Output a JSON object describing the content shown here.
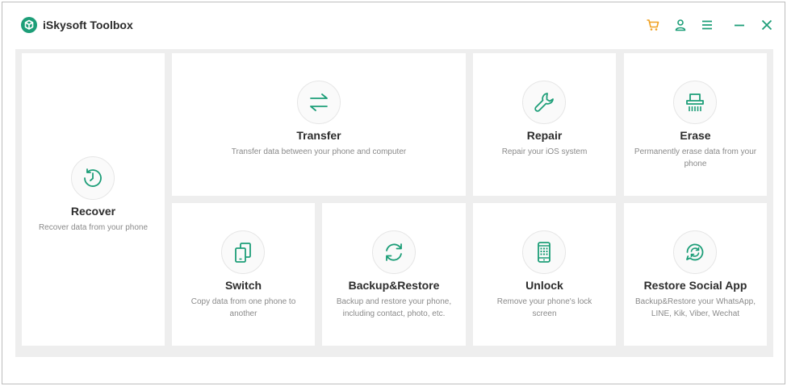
{
  "app": {
    "title": "iSkysoft Toolbox"
  },
  "toolbar": {
    "cart_icon": "cart-icon",
    "account_icon": "account-icon",
    "menu_icon": "menu-icon",
    "minimize_icon": "minimize-icon",
    "close_icon": "close-icon"
  },
  "colors": {
    "accent": "#1d9e78",
    "cart": "#f0a020",
    "background": "#eeeeee",
    "card": "#ffffff"
  },
  "cards": {
    "recover": {
      "title": "Recover",
      "desc": "Recover data from your phone",
      "icon": "clock-icon"
    },
    "transfer": {
      "title": "Transfer",
      "desc": "Transfer data between your phone and computer",
      "icon": "arrows-icon"
    },
    "repair": {
      "title": "Repair",
      "desc": "Repair your iOS system",
      "icon": "wrench-icon"
    },
    "erase": {
      "title": "Erase",
      "desc": "Permanently erase data from your phone",
      "icon": "shredder-icon"
    },
    "switch": {
      "title": "Switch",
      "desc": "Copy data from one phone to another",
      "icon": "phones-icon"
    },
    "backup": {
      "title": "Backup&Restore",
      "desc": "Backup and restore your phone, including contact, photo, etc.",
      "icon": "sync-icon"
    },
    "unlock": {
      "title": "Unlock",
      "desc": "Remove your phone's lock screen",
      "icon": "keypad-phone-icon"
    },
    "social": {
      "title": "Restore Social App",
      "desc": "Backup&Restore your WhatsApp, LINE, Kik, Viber, Wechat",
      "icon": "chat-sync-icon"
    }
  }
}
